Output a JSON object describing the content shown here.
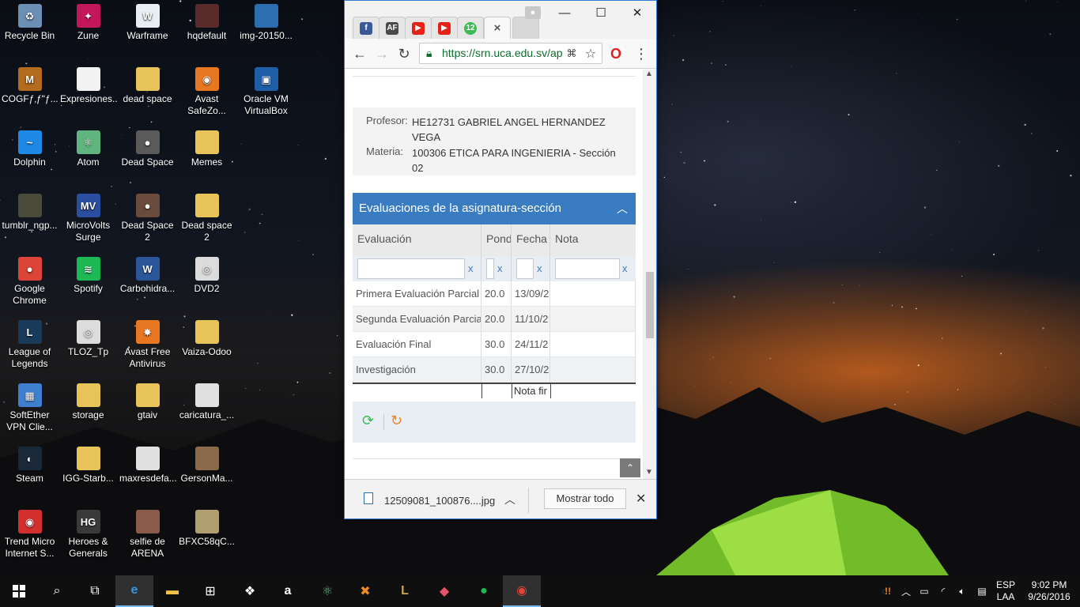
{
  "desktop": {
    "icons": [
      {
        "label": "Recycle Bin",
        "icon": "recycle-bin-icon",
        "color": "#6b8fb5",
        "glyph": "♻"
      },
      {
        "label": "Zune",
        "icon": "zune-icon",
        "color": "#c2185b",
        "glyph": "✦"
      },
      {
        "label": "Warframe",
        "icon": "warframe-icon",
        "color": "#e8eef4",
        "glyph": "W"
      },
      {
        "label": "hqdefault",
        "icon": "image-thumbnail-icon",
        "color": "#5a2b2b",
        "glyph": ""
      },
      {
        "label": "img-20150...",
        "icon": "image-thumbnail-icon",
        "color": "#2b6fb0",
        "glyph": ""
      },
      {
        "label": "COGFƒ‚ƒ\"ƒ...ƒtƒ\"ƒeƒBƒ...",
        "icon": "mhf-game-icon",
        "color": "#b36b1f",
        "glyph": "M"
      },
      {
        "label": "Expresiones...",
        "icon": "text-file-icon",
        "color": "#f2f2f2",
        "glyph": ""
      },
      {
        "label": "dead space",
        "icon": "folder-icon",
        "color": "#e8c35a",
        "glyph": ""
      },
      {
        "label": "Avast SafeZo...",
        "icon": "avast-safezone-icon",
        "color": "#e87722",
        "glyph": "◉"
      },
      {
        "label": "Oracle VM VirtualBox",
        "icon": "virtualbox-icon",
        "color": "#1f5fa8",
        "glyph": "▣"
      },
      {
        "label": "Dolphin",
        "icon": "dolphin-icon",
        "color": "#1e88e5",
        "glyph": "~"
      },
      {
        "label": "Atom",
        "icon": "atom-icon",
        "color": "#5fb57d",
        "glyph": "⚛"
      },
      {
        "label": "Dead Space",
        "icon": "dead-space-icon",
        "color": "#5a5a5a",
        "glyph": "●"
      },
      {
        "label": "Memes",
        "icon": "folder-icon",
        "color": "#e8c35a",
        "glyph": ""
      },
      {
        "label": "tumblr_ngp...",
        "icon": "image-thumbnail-icon",
        "color": "#4a4a3a",
        "glyph": ""
      },
      {
        "label": "MicroVolts Surge",
        "icon": "microvolts-icon",
        "color": "#2b4fa0",
        "glyph": "MV"
      },
      {
        "label": "Dead Space 2",
        "icon": "dead-space-2-icon",
        "color": "#6a4a3a",
        "glyph": "●"
      },
      {
        "label": "Dead space 2",
        "icon": "folder-icon",
        "color": "#e8c35a",
        "glyph": ""
      },
      {
        "label": "Google Chrome",
        "icon": "chrome-icon",
        "color": "#db4437",
        "glyph": "●"
      },
      {
        "label": "Spotify",
        "icon": "spotify-icon",
        "color": "#1db954",
        "glyph": "≋"
      },
      {
        "label": "Carbohidra...",
        "icon": "word-document-icon",
        "color": "#2b579a",
        "glyph": "W"
      },
      {
        "label": "DVD2",
        "icon": "disc-image-icon",
        "color": "#dcdcdc",
        "glyph": "◎"
      },
      {
        "label": "League of Legends",
        "icon": "league-of-legends-icon",
        "color": "#1a3a5a",
        "glyph": "L"
      },
      {
        "label": "TLOZ_Tp",
        "icon": "disc-image-icon",
        "color": "#dcdcdc",
        "glyph": "◎"
      },
      {
        "label": "Avast Free Antivirus",
        "icon": "avast-icon",
        "color": "#e87722",
        "glyph": "✸"
      },
      {
        "label": "Vaiza-Odoo",
        "icon": "folder-icon",
        "color": "#e8c35a",
        "glyph": ""
      },
      {
        "label": "SoftEther VPN Clie...",
        "icon": "softether-vpn-icon",
        "color": "#3f7fd0",
        "glyph": "▦"
      },
      {
        "label": "storage",
        "icon": "folder-icon",
        "color": "#e8c35a",
        "glyph": ""
      },
      {
        "label": "gtaiv",
        "icon": "folder-icon",
        "color": "#e8c35a",
        "glyph": ""
      },
      {
        "label": "caricatura_...",
        "icon": "image-thumbnail-icon",
        "color": "#e0e0e0",
        "glyph": ""
      },
      {
        "label": "Steam",
        "icon": "steam-icon",
        "color": "#1b2838",
        "glyph": "◐"
      },
      {
        "label": "IGG-Starb...",
        "icon": "folder-icon",
        "color": "#e8c35a",
        "glyph": ""
      },
      {
        "label": "maxresdefa...",
        "icon": "image-thumbnail-icon",
        "color": "#e0e0e0",
        "glyph": ""
      },
      {
        "label": "GersonMa...",
        "icon": "image-thumbnail-icon",
        "color": "#8a6a4a",
        "glyph": ""
      },
      {
        "label": "Trend Micro Internet S...",
        "icon": "trend-micro-icon",
        "color": "#d32f2f",
        "glyph": "◉"
      },
      {
        "label": "Heroes & Generals",
        "icon": "heroes-generals-icon",
        "color": "#3a3a3a",
        "glyph": "HG"
      },
      {
        "label": "selfie de ARENA",
        "icon": "image-thumbnail-icon",
        "color": "#8a5a4a",
        "glyph": ""
      },
      {
        "label": "BFXC58qC...",
        "icon": "image-thumbnail-icon",
        "color": "#b0a070",
        "glyph": ""
      }
    ]
  },
  "browser": {
    "tabs": [
      {
        "icon": "facebook-icon",
        "color": "#3b5998",
        "glyph": "f"
      },
      {
        "icon": "af-icon",
        "color": "#4a4a4a",
        "glyph": "AF"
      },
      {
        "icon": "youtube-icon",
        "color": "#e62117",
        "glyph": "▶"
      },
      {
        "icon": "youtube-icon",
        "color": "#e62117",
        "glyph": "▶"
      },
      {
        "icon": "counter-badge-icon",
        "color": "#3cba54",
        "glyph": "12"
      },
      {
        "icon": "close-icon",
        "color": "#555555",
        "glyph": "×"
      }
    ],
    "url": "https://srn.uca.edu.sv/ap",
    "download": {
      "filename": "12509081_100876....jpg",
      "show_all": "Mostrar todo"
    }
  },
  "page": {
    "profesor_label": "Profesor:",
    "profesor_value": "HE12731 GABRIEL ANGEL HERNANDEZ VEGA",
    "materia_label": "Materia:",
    "materia_value": "100306 ETICA PARA INGENIERIA   -   Sección 02",
    "panel_title": "Evaluaciones de la asignatura-sección",
    "columns": [
      "Evaluación",
      "Pond",
      "Fecha r",
      "Nota"
    ],
    "filter_clear": "x",
    "rows": [
      [
        "Primera Evaluación Parcial",
        "20.0",
        "13/09/2",
        ""
      ],
      [
        "Segunda Evaluación Parcial",
        "20.0",
        "11/10/2",
        ""
      ],
      [
        "Evaluación Final",
        "30.0",
        "24/11/2",
        ""
      ],
      [
        "Investigación",
        "30.0",
        "27/10/2",
        ""
      ]
    ],
    "summary_label": "Nota fir"
  },
  "taskbar": {
    "language": "ESP",
    "layout": "LAA",
    "time": "9:02 PM",
    "date": "9/26/2016"
  },
  "colors": {
    "accent": "#3a7cc2",
    "taskbar": "#101010"
  }
}
